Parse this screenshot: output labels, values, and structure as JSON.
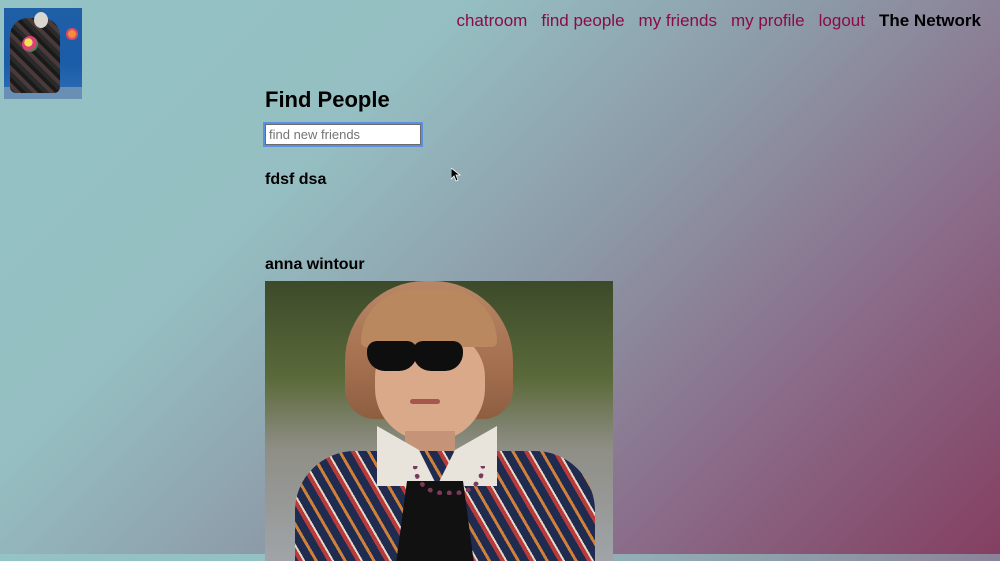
{
  "header": {
    "avatar_alt": "profile picture",
    "nav": [
      {
        "label": "chatroom"
      },
      {
        "label": "find people"
      },
      {
        "label": "my friends"
      },
      {
        "label": "my profile"
      },
      {
        "label": "logout"
      }
    ],
    "brand": "The Network"
  },
  "main": {
    "title": "Find People",
    "search": {
      "placeholder": "find new friends",
      "value": ""
    },
    "results": [
      {
        "name": "fdsf dsa"
      },
      {
        "name": "anna wintour"
      }
    ]
  },
  "colors": {
    "nav_link": "#8a0b4a",
    "focus_ring": "#5d8fe0"
  }
}
